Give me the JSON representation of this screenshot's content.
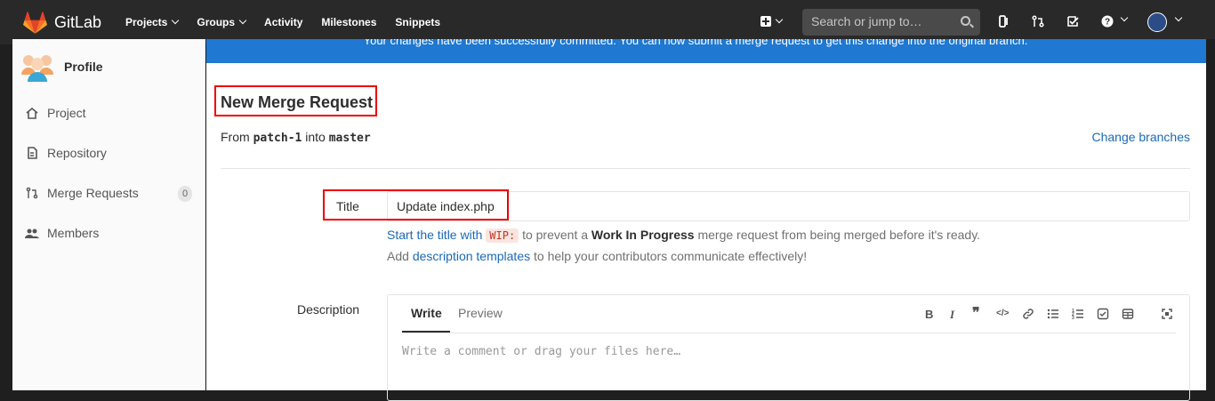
{
  "brand": {
    "name": "GitLab"
  },
  "nav": [
    {
      "label": "Projects",
      "dropdown": true
    },
    {
      "label": "Groups",
      "dropdown": true
    },
    {
      "label": "Activity",
      "dropdown": false
    },
    {
      "label": "Milestones",
      "dropdown": false
    },
    {
      "label": "Snippets",
      "dropdown": false
    }
  ],
  "search": {
    "placeholder": "Search or jump to…"
  },
  "sidebar": {
    "title": "Profile",
    "items": [
      {
        "label": "Project",
        "icon": "home-icon"
      },
      {
        "label": "Repository",
        "icon": "doc-icon"
      },
      {
        "label": "Merge Requests",
        "icon": "merge-request-icon",
        "badge": "0"
      },
      {
        "label": "Members",
        "icon": "users-icon"
      }
    ]
  },
  "flash": {
    "message": "Your changes have been successfully committed. You can now submit a merge request to get this change into the original branch."
  },
  "page": {
    "title": "New Merge Request",
    "from_prefix": "From",
    "source_branch": "patch-1",
    "into": "into",
    "target_branch": "master",
    "change_branches": "Change branches"
  },
  "form": {
    "title_label": "Title",
    "title_value": "Update index.php",
    "hint_start": "Start the title with",
    "wip": "WIP:",
    "hint_mid": "to prevent a",
    "hint_bold": "Work In Progress",
    "hint_end": "merge request from being merged before it's ready.",
    "add": "Add",
    "desc_templates": "description templates",
    "add_end": "to help your contributors communicate effectively!",
    "description_label": "Description",
    "tab_write": "Write",
    "tab_preview": "Preview",
    "placeholder": "Write a comment or drag your files here…"
  },
  "colors": {
    "accent": "#1f78d1",
    "highlight": "#ee0000",
    "topbar": "#292929"
  }
}
